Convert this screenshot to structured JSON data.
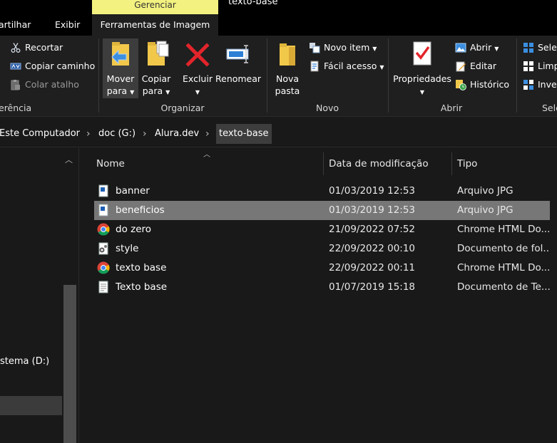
{
  "window": {
    "contextual_tab": "Gerenciar",
    "title": "texto-base"
  },
  "tabs": [
    {
      "label": "artilhar"
    },
    {
      "label": "Exibir"
    },
    {
      "label": "Ferramentas de Imagem"
    }
  ],
  "ribbon": {
    "clipboard": {
      "recortar": "Recortar",
      "copiar_caminho": "Copiar caminho",
      "colar_atalho": "Colar atalho",
      "group_label": "erência"
    },
    "organizar": {
      "mover": [
        "Mover",
        "para"
      ],
      "copiar": [
        "Copiar",
        "para"
      ],
      "excluir": "Excluir",
      "renomear": "Renomear",
      "group_label": "Organizar"
    },
    "novo": {
      "nova_pasta": [
        "Nova",
        "pasta"
      ],
      "novo_item": "Novo item",
      "facil_acesso": "Fácil acesso",
      "group_label": "Novo"
    },
    "abrir": {
      "propriedades": "Propriedades",
      "abrir": "Abrir",
      "editar": "Editar",
      "historico": "Histórico",
      "group_label": "Abrir"
    },
    "selecionar": {
      "selecionar_tudo": "Selec",
      "limpar": "Limp",
      "inverter": "Inver",
      "group_label": "Sele"
    }
  },
  "address": {
    "crumbs": [
      "Este Computador",
      "doc (G:)",
      "Alura.dev",
      "texto-base"
    ]
  },
  "nav": {
    "drive_d": "stema (D:)"
  },
  "columns": {
    "name": "Nome",
    "date": "Data de modificação",
    "type": "Tipo"
  },
  "files": [
    {
      "name": "banner",
      "date": "01/03/2019 12:53",
      "type": "Arquivo JPG",
      "icon": "jpg-file-icon"
    },
    {
      "name": "beneficios",
      "date": "01/03/2019 12:53",
      "type": "Arquivo JPG",
      "icon": "jpg-file-icon",
      "selected": true
    },
    {
      "name": "do zero",
      "date": "21/09/2022 07:52",
      "type": "Chrome HTML Do...",
      "icon": "chrome-html-icon"
    },
    {
      "name": "style",
      "date": "22/09/2022 00:10",
      "type": "Documento de fol...",
      "icon": "css-file-icon"
    },
    {
      "name": "texto base",
      "date": "22/09/2022 00:11",
      "type": "Chrome HTML Do...",
      "icon": "chrome-html-icon"
    },
    {
      "name": "Texto base",
      "date": "01/07/2019 15:18",
      "type": "Documento de Te...",
      "icon": "text-file-icon"
    }
  ],
  "colors": {
    "contextual_tab": "#f3f17f",
    "selected_row": "#777777",
    "background": "#191919",
    "ribbon": "#1f1f1f"
  }
}
